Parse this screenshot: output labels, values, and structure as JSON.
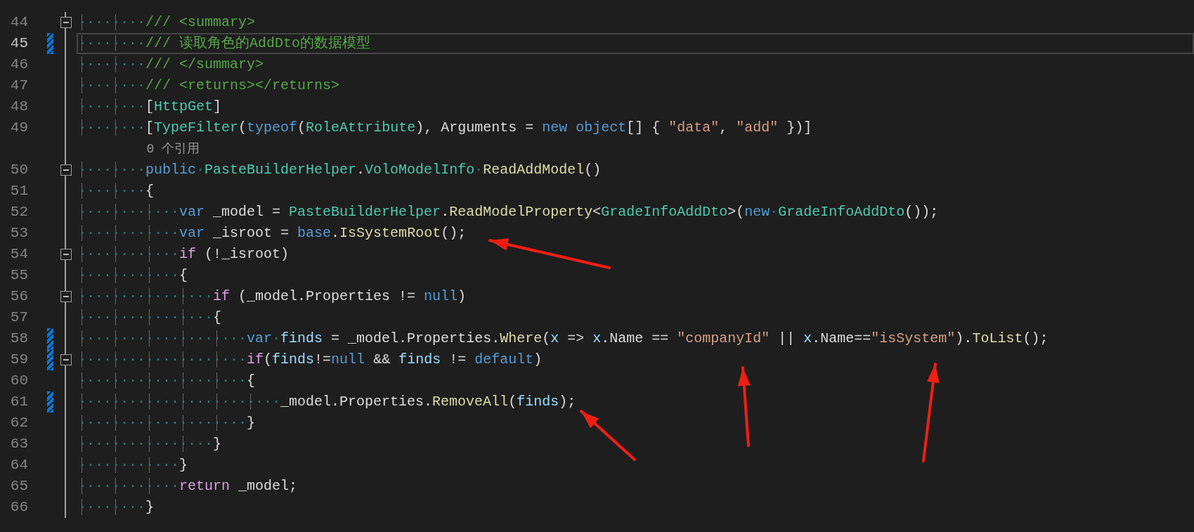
{
  "lines": [
    {
      "kind": "code",
      "number": "44",
      "indent": "········",
      "current": false,
      "changed": false,
      "foldable": true,
      "tokens": [
        {
          "kind": "comment",
          "text": "/// <summary>"
        }
      ]
    },
    {
      "kind": "code",
      "number": "45",
      "indent": "········",
      "current": true,
      "changed": true,
      "foldable": false,
      "tokens": [
        {
          "kind": "comment",
          "text": "/// 读取角色的AddDto的数据模型"
        }
      ]
    },
    {
      "kind": "code",
      "number": "46",
      "indent": "········",
      "current": false,
      "changed": false,
      "foldable": false,
      "tokens": [
        {
          "kind": "comment",
          "text": "/// </summary>"
        }
      ]
    },
    {
      "kind": "code",
      "number": "47",
      "indent": "········",
      "current": false,
      "changed": false,
      "foldable": false,
      "tokens": [
        {
          "kind": "comment",
          "text": "/// <returns></returns>"
        }
      ]
    },
    {
      "kind": "code",
      "number": "48",
      "indent": "········",
      "current": false,
      "changed": false,
      "foldable": false,
      "tokens": [
        {
          "kind": "plain",
          "text": "["
        },
        {
          "kind": "type",
          "text": "HttpGet"
        },
        {
          "kind": "plain",
          "text": "]"
        }
      ]
    },
    {
      "kind": "code",
      "number": "49",
      "indent": "········",
      "current": false,
      "changed": false,
      "foldable": false,
      "tokens": [
        {
          "kind": "plain",
          "text": "["
        },
        {
          "kind": "type",
          "text": "TypeFilter"
        },
        {
          "kind": "plain",
          "text": "("
        },
        {
          "kind": "keyword",
          "text": "typeof"
        },
        {
          "kind": "plain",
          "text": "("
        },
        {
          "kind": "type",
          "text": "RoleAttribute"
        },
        {
          "kind": "plain",
          "text": "), Arguments = "
        },
        {
          "kind": "keyword",
          "text": "new object"
        },
        {
          "kind": "plain",
          "text": "[] { "
        },
        {
          "kind": "string",
          "text": "\"data\""
        },
        {
          "kind": "plain",
          "text": ", "
        },
        {
          "kind": "string",
          "text": "\"add\""
        },
        {
          "kind": "plain",
          "text": " })]"
        }
      ]
    },
    {
      "kind": "codelens",
      "tokens": [
        {
          "kind": "codelens",
          "text": "0 个引用"
        }
      ]
    },
    {
      "kind": "code",
      "number": "50",
      "indent": "········",
      "current": false,
      "changed": false,
      "foldable": true,
      "tokens": [
        {
          "kind": "keyword",
          "text": "public"
        },
        {
          "kind": "whitespace",
          "text": "·"
        },
        {
          "kind": "type",
          "text": "PasteBuilderHelper"
        },
        {
          "kind": "plain",
          "text": "."
        },
        {
          "kind": "type",
          "text": "VoloModelInfo"
        },
        {
          "kind": "whitespace",
          "text": "·"
        },
        {
          "kind": "method",
          "text": "ReadAddModel"
        },
        {
          "kind": "plain",
          "text": "()"
        }
      ]
    },
    {
      "kind": "code",
      "number": "51",
      "indent": "········",
      "current": false,
      "changed": false,
      "foldable": false,
      "tokens": [
        {
          "kind": "plain",
          "text": "{"
        }
      ]
    },
    {
      "kind": "code",
      "number": "52",
      "indent": "············",
      "current": false,
      "changed": false,
      "foldable": false,
      "tokens": [
        {
          "kind": "keyword",
          "text": "var"
        },
        {
          "kind": "plain",
          "text": " _model = "
        },
        {
          "kind": "type",
          "text": "PasteBuilderHelper"
        },
        {
          "kind": "plain",
          "text": "."
        },
        {
          "kind": "method",
          "text": "ReadModelProperty"
        },
        {
          "kind": "plain",
          "text": "<"
        },
        {
          "kind": "type",
          "text": "GradeInfoAddDto"
        },
        {
          "kind": "plain",
          "text": ">("
        },
        {
          "kind": "keyword",
          "text": "new"
        },
        {
          "kind": "whitespace",
          "text": "·"
        },
        {
          "kind": "type",
          "text": "GradeInfoAddDto"
        },
        {
          "kind": "plain",
          "text": "());"
        }
      ]
    },
    {
      "kind": "code",
      "number": "53",
      "indent": "············",
      "current": false,
      "changed": false,
      "foldable": false,
      "tokens": [
        {
          "kind": "keyword",
          "text": "var"
        },
        {
          "kind": "plain",
          "text": " _isroot = "
        },
        {
          "kind": "keyword",
          "text": "base"
        },
        {
          "kind": "plain",
          "text": "."
        },
        {
          "kind": "method",
          "text": "IsSystemRoot"
        },
        {
          "kind": "plain",
          "text": "();"
        }
      ]
    },
    {
      "kind": "code",
      "number": "54",
      "indent": "············",
      "current": false,
      "changed": false,
      "foldable": true,
      "tokens": [
        {
          "kind": "control",
          "text": "if"
        },
        {
          "kind": "plain",
          "text": " (!_isroot)"
        }
      ]
    },
    {
      "kind": "code",
      "number": "55",
      "indent": "············",
      "current": false,
      "changed": false,
      "foldable": false,
      "tokens": [
        {
          "kind": "plain",
          "text": "{"
        }
      ]
    },
    {
      "kind": "code",
      "number": "56",
      "indent": "················",
      "current": false,
      "changed": false,
      "foldable": true,
      "tokens": [
        {
          "kind": "control",
          "text": "if"
        },
        {
          "kind": "plain",
          "text": " (_model.Properties != "
        },
        {
          "kind": "keyword",
          "text": "null"
        },
        {
          "kind": "plain",
          "text": ")"
        }
      ]
    },
    {
      "kind": "code",
      "number": "57",
      "indent": "················",
      "current": false,
      "changed": false,
      "foldable": false,
      "tokens": [
        {
          "kind": "plain",
          "text": "{"
        }
      ]
    },
    {
      "kind": "code",
      "number": "58",
      "indent": "····················",
      "current": false,
      "changed": true,
      "foldable": false,
      "tokens": [
        {
          "kind": "keyword",
          "text": "var"
        },
        {
          "kind": "whitespace",
          "text": "·"
        },
        {
          "kind": "local",
          "text": "finds"
        },
        {
          "kind": "plain",
          "text": " = _model.Properties."
        },
        {
          "kind": "method",
          "text": "Where"
        },
        {
          "kind": "plain",
          "text": "("
        },
        {
          "kind": "local",
          "text": "x"
        },
        {
          "kind": "plain",
          "text": " => "
        },
        {
          "kind": "local",
          "text": "x"
        },
        {
          "kind": "plain",
          "text": ".Name == "
        },
        {
          "kind": "string",
          "text": "\"companyId\""
        },
        {
          "kind": "plain",
          "text": " || "
        },
        {
          "kind": "local",
          "text": "x"
        },
        {
          "kind": "plain",
          "text": ".Name=="
        },
        {
          "kind": "string",
          "text": "\"isSystem\""
        },
        {
          "kind": "plain",
          "text": ")."
        },
        {
          "kind": "method",
          "text": "ToList"
        },
        {
          "kind": "plain",
          "text": "();"
        }
      ]
    },
    {
      "kind": "code",
      "number": "59",
      "indent": "····················",
      "current": false,
      "changed": true,
      "foldable": true,
      "tokens": [
        {
          "kind": "control",
          "text": "if"
        },
        {
          "kind": "plain",
          "text": "("
        },
        {
          "kind": "local",
          "text": "finds"
        },
        {
          "kind": "plain",
          "text": "!="
        },
        {
          "kind": "keyword",
          "text": "null"
        },
        {
          "kind": "plain",
          "text": " && "
        },
        {
          "kind": "local",
          "text": "finds"
        },
        {
          "kind": "plain",
          "text": " != "
        },
        {
          "kind": "keyword",
          "text": "default"
        },
        {
          "kind": "plain",
          "text": ")"
        }
      ]
    },
    {
      "kind": "code",
      "number": "60",
      "indent": "····················",
      "current": false,
      "changed": false,
      "foldable": false,
      "tokens": [
        {
          "kind": "plain",
          "text": "{"
        }
      ]
    },
    {
      "kind": "code",
      "number": "61",
      "indent": "························",
      "current": false,
      "changed": true,
      "foldable": false,
      "tokens": [
        {
          "kind": "plain",
          "text": "_model.Properties."
        },
        {
          "kind": "method",
          "text": "RemoveAll"
        },
        {
          "kind": "plain",
          "text": "("
        },
        {
          "kind": "local",
          "text": "finds"
        },
        {
          "kind": "plain",
          "text": ");"
        }
      ]
    },
    {
      "kind": "code",
      "number": "62",
      "indent": "····················",
      "current": false,
      "changed": false,
      "foldable": false,
      "tokens": [
        {
          "kind": "plain",
          "text": "}"
        }
      ]
    },
    {
      "kind": "code",
      "number": "63",
      "indent": "················",
      "current": false,
      "changed": false,
      "foldable": false,
      "tokens": [
        {
          "kind": "plain",
          "text": "}"
        }
      ]
    },
    {
      "kind": "code",
      "number": "64",
      "indent": "············",
      "current": false,
      "changed": false,
      "foldable": false,
      "tokens": [
        {
          "kind": "plain",
          "text": "}"
        }
      ]
    },
    {
      "kind": "code",
      "number": "65",
      "indent": "············",
      "current": false,
      "changed": false,
      "foldable": false,
      "tokens": [
        {
          "kind": "control",
          "text": "return"
        },
        {
          "kind": "plain",
          "text": " _model;"
        }
      ]
    },
    {
      "kind": "code",
      "number": "66",
      "indent": "········",
      "current": false,
      "changed": false,
      "foldable": false,
      "tokens": [
        {
          "kind": "plain",
          "text": "}"
        }
      ]
    }
  ]
}
